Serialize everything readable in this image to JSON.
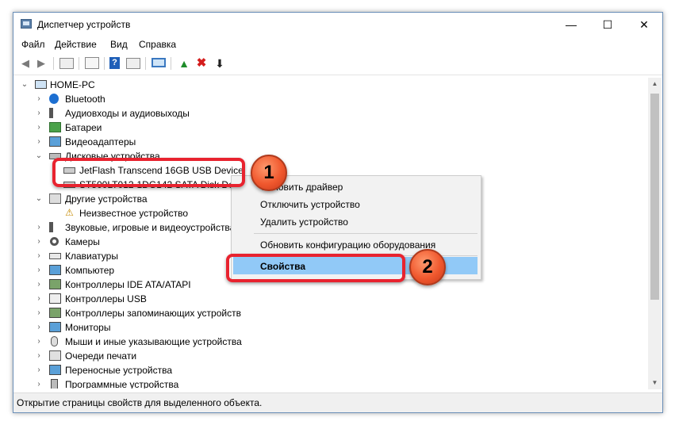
{
  "window": {
    "title": "Диспетчер устройств"
  },
  "menu": [
    "Файл",
    "Действие",
    "Вид",
    "Справка"
  ],
  "tree": {
    "root": "HOME-PC",
    "items": [
      {
        "label": "Bluetooth",
        "icon": "bluetooth-icon"
      },
      {
        "label": "Аудиовходы и аудиовыходы",
        "icon": "speaker-icon"
      },
      {
        "label": "Батареи",
        "icon": "battery-icon"
      },
      {
        "label": "Видеоадаптеры",
        "icon": "display-adapter-icon"
      },
      {
        "label": "Дисковые устройства",
        "icon": "disk-icon"
      },
      {
        "label": "JetFlash Transcend 16GB USB Device",
        "icon": "drive-icon"
      },
      {
        "label": "ST500LT012-1DG142 SATA Disk Device",
        "icon": "drive-icon"
      },
      {
        "label": "Другие устройства",
        "icon": "other-devices-icon"
      },
      {
        "label": "Неизвестное устройство",
        "icon": "warning-device-icon"
      },
      {
        "label": "Звуковые, игровые и видеоустройства",
        "icon": "sound-icon"
      },
      {
        "label": "Камеры",
        "icon": "camera-icon"
      },
      {
        "label": "Клавиатуры",
        "icon": "keyboard-icon"
      },
      {
        "label": "Компьютер",
        "icon": "computer-icon"
      },
      {
        "label": "Контроллеры IDE ATA/ATAPI",
        "icon": "ide-controller-icon"
      },
      {
        "label": "Контроллеры USB",
        "icon": "usb-icon"
      },
      {
        "label": "Контроллеры запоминающих устройств",
        "icon": "storage-controller-icon"
      },
      {
        "label": "Мониторы",
        "icon": "monitor-icon"
      },
      {
        "label": "Мыши и иные указывающие устройства",
        "icon": "mouse-icon"
      },
      {
        "label": "Очереди печати",
        "icon": "printer-icon"
      },
      {
        "label": "Переносные устройства",
        "icon": "portable-device-icon"
      },
      {
        "label": "Программные устройства",
        "icon": "software-device-icon"
      }
    ]
  },
  "context_menu": {
    "items": [
      "Обновить драйвер",
      "Отключить устройство",
      "Удалить устройство",
      "Обновить конфигурацию оборудования",
      "Свойства"
    ]
  },
  "callouts": {
    "step1": "1",
    "step2": "2"
  },
  "status": "Открытие страницы свойств для выделенного объекта.",
  "colors": {
    "highlight": "#91c9f7",
    "callout_border": "#e8232f",
    "badge": "#f0582e"
  }
}
